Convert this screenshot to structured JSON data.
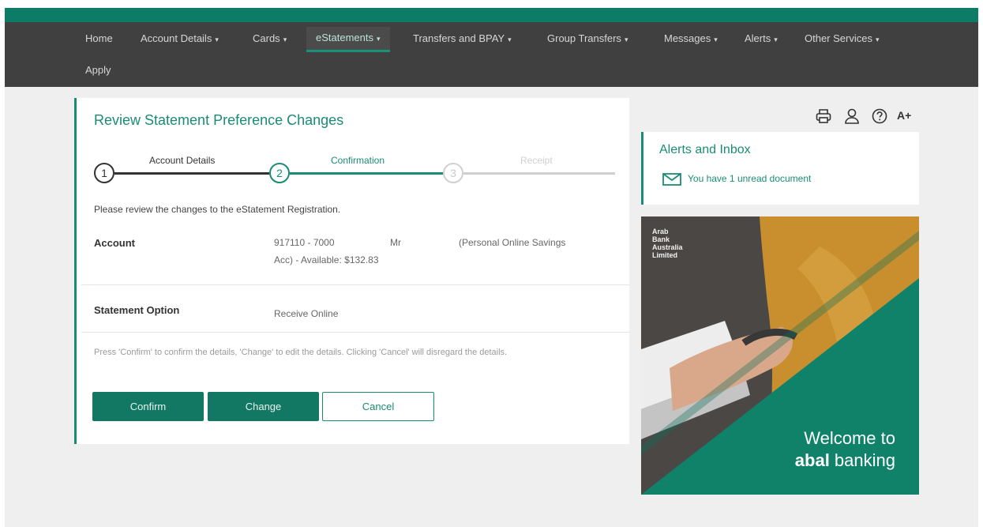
{
  "nav": {
    "items": [
      {
        "label": "Home",
        "caret": ""
      },
      {
        "label": "Account Details",
        "caret": "▾"
      },
      {
        "label": "Cards",
        "caret": "▾"
      },
      {
        "label": "eStatements",
        "caret": "▾"
      },
      {
        "label": "Transfers and BPAY",
        "caret": "▾"
      },
      {
        "label": "Group Transfers",
        "caret": "▾"
      },
      {
        "label": "Messages",
        "caret": "▾"
      },
      {
        "label": "Alerts",
        "caret": "▾"
      },
      {
        "label": "Other Services",
        "caret": "▾"
      },
      {
        "label": "Apply",
        "caret": ""
      }
    ]
  },
  "review": {
    "title": "Review Statement Preference Changes",
    "steps": [
      {
        "number": "1",
        "label": "Account Details"
      },
      {
        "number": "2",
        "label": "Confirmation"
      },
      {
        "number": "3",
        "label": "Receipt"
      }
    ],
    "intro": "Please review the changes to the eStatement Registration.",
    "account_label": "Account",
    "account_value_line1": "917110 - 7000",
    "account_value_name": "Mr",
    "account_value_type": "(Personal Online Savings",
    "account_value_line2": "Acc) - Available: $132.83",
    "statement_label": "Statement Option",
    "statement_value": "Receive Online",
    "note": "Press 'Confirm' to confirm the details, 'Change' to edit the details. Clicking 'Cancel' will disregard the details.",
    "buttons": {
      "confirm": "Confirm",
      "change": "Change",
      "cancel": "Cancel"
    }
  },
  "toolbar": {
    "font_size_label": "A+",
    "icons": [
      "printer-icon",
      "user-icon",
      "help-icon",
      "font-size-icon"
    ]
  },
  "alerts": {
    "title": "Alerts and Inbox",
    "message": "You have 1 unread document"
  },
  "promo": {
    "bank_name_lines": [
      "Arab",
      "Bank",
      "Australia",
      "Limited"
    ],
    "welcome": "Welcome to",
    "brand_bold": "abal",
    "brand_rest": " banking"
  },
  "colors": {
    "accent": "#1a8c74",
    "nav_bg": "#404040",
    "button_primary": "#127864",
    "page_bg": "#efefef"
  }
}
